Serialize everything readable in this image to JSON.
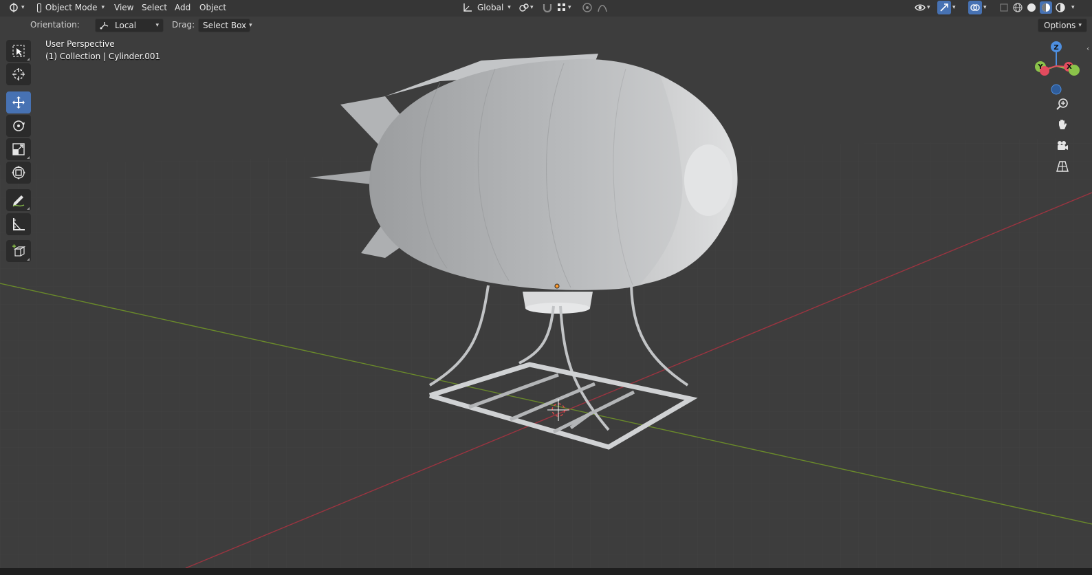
{
  "header": {
    "mode": "Object Mode",
    "menus": [
      "View",
      "Select",
      "Add",
      "Object"
    ],
    "transform_orientation": "Global"
  },
  "tool_settings": {
    "orientation_label": "Orientation:",
    "orientation_value": "Local",
    "drag_label": "Drag:",
    "drag_value": "Select Box",
    "options_label": "Options"
  },
  "viewport": {
    "perspective": "User Perspective",
    "collection": "(1) Collection | Cylinder.001"
  },
  "toolbar": {
    "tools": [
      "select-box",
      "cursor",
      "move",
      "rotate",
      "scale",
      "transform",
      "annotate",
      "measure",
      "add-cube"
    ],
    "active_tool": "move"
  },
  "gizmo": {
    "x_label": "X",
    "y_label": "Y",
    "z_label": "Z"
  },
  "colors": {
    "active_tool": "#4772b3",
    "axis_x": "#e34b5e",
    "axis_y": "#8bc34a",
    "axis_z": "#4e8fe0",
    "x_line": "#9c3440",
    "y_line": "#6a8a2a"
  }
}
